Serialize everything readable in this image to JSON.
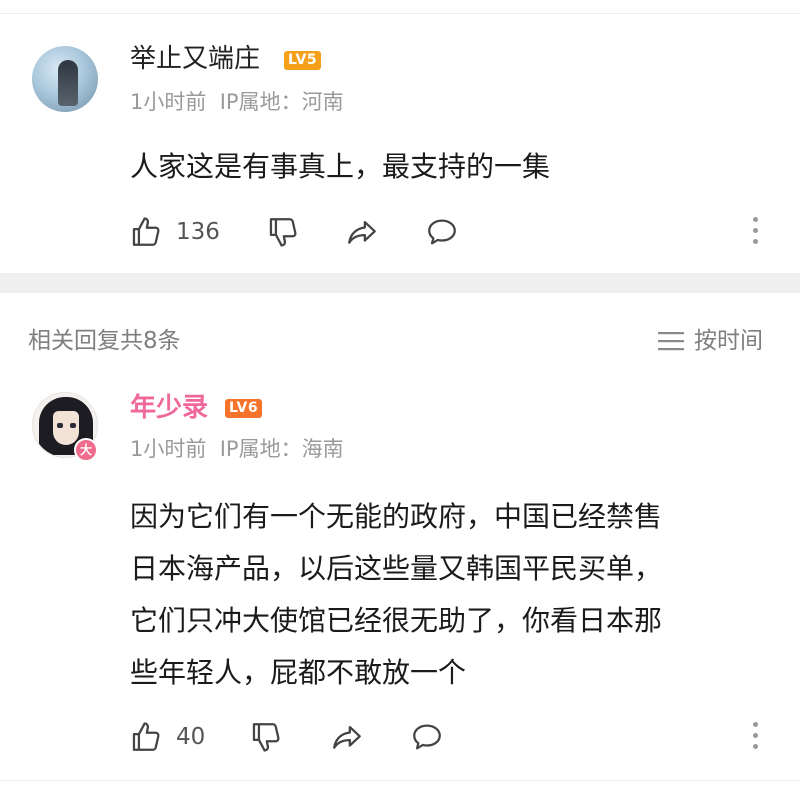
{
  "comments": [
    {
      "username": "举止又端庄",
      "level": "LV5",
      "time": "1小时前",
      "ip_location": "IP属地：河南",
      "text_lines": [
        "人家这是有事真上，最支持的一集"
      ],
      "like_count": "136",
      "level_color": "#f5a019"
    },
    {
      "username": "年少录",
      "level": "LV6",
      "badge": "大",
      "time": "1小时前",
      "ip_location": "IP属地：海南",
      "text_lines": [
        "因为它们有一个无能的政府，中国已经禁售",
        "日本海产品，以后这些量又韩国平民买单，",
        "它们只冲大使馆已经很无助了，你看日本那",
        "些年轻人，屁都不敢放一个"
      ],
      "like_count": "40",
      "level_color": "#f6732b",
      "username_color": "#f0679a"
    }
  ],
  "related": {
    "label": "相关回复共8条",
    "sort_label": "按时间"
  },
  "icons": {
    "like": "thumbs-up-icon",
    "dislike": "thumbs-down-icon",
    "share": "share-arrow-icon",
    "reply": "speech-bubble-icon",
    "more": "vertical-dots-icon",
    "sort": "sort-lines-icon"
  }
}
